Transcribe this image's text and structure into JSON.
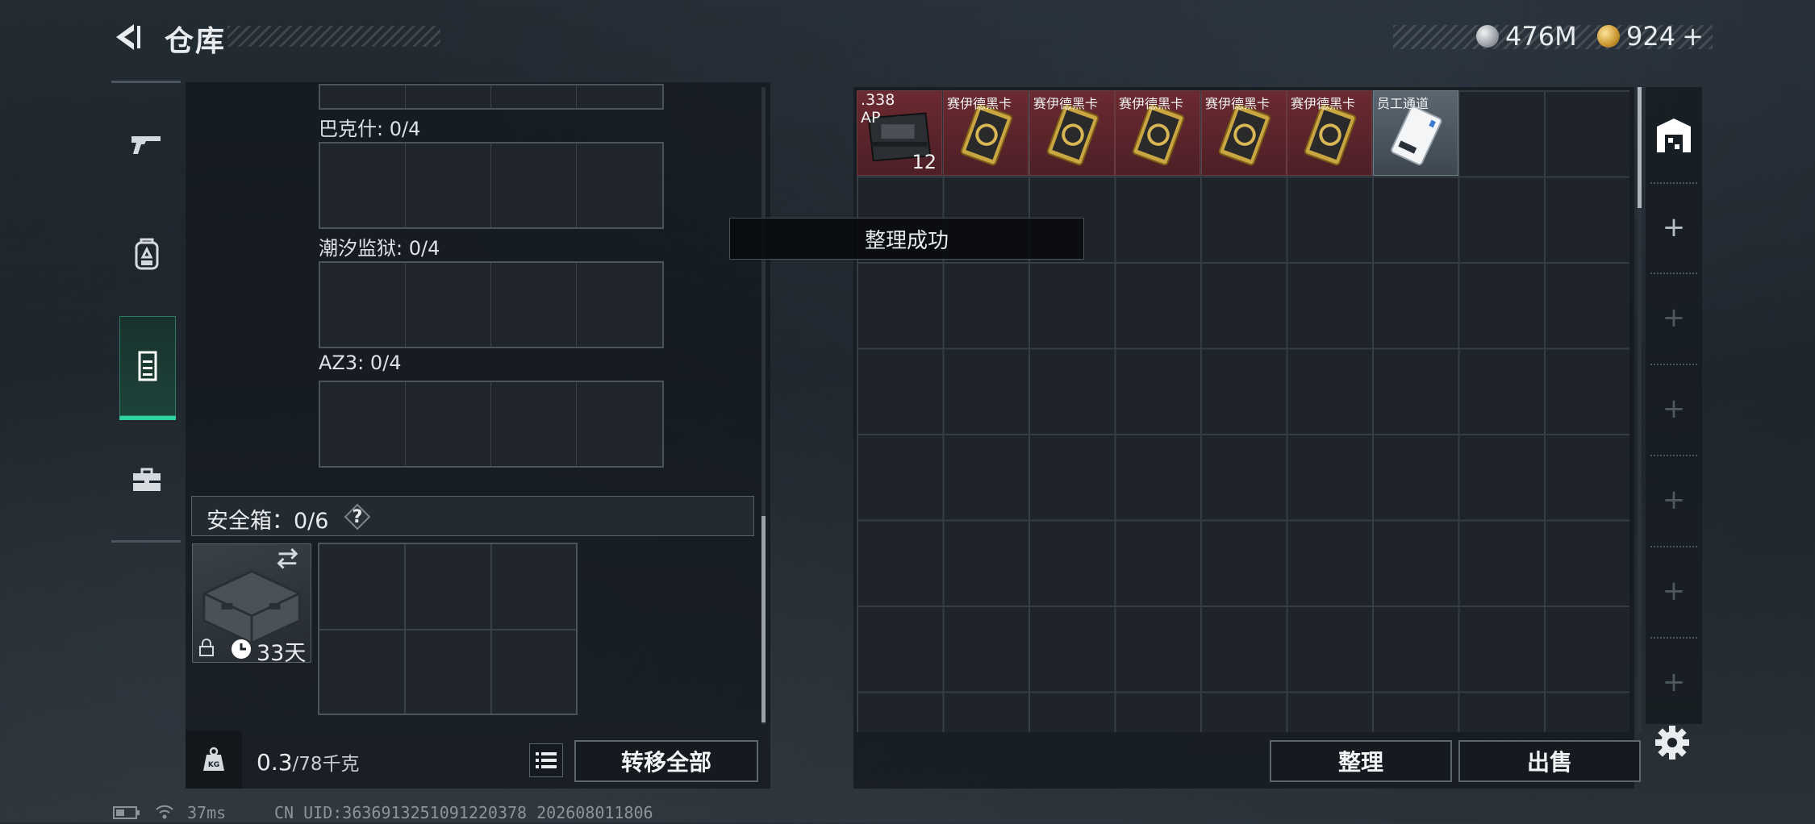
{
  "header": {
    "title": "仓库",
    "currency": [
      {
        "icon": "silver-coin-icon",
        "value": "476M"
      },
      {
        "icon": "gold-coin-icon",
        "value": "924"
      }
    ],
    "add_symbol": "+"
  },
  "nav": {
    "items": [
      "pistol-icon",
      "backpack-icon",
      "chest-rig-icon",
      "toolbox-icon"
    ],
    "active_index": 2
  },
  "left_panel": {
    "slots": [
      {
        "label": "巴克什: 0/4"
      },
      {
        "label": "潮汐监狱: 0/4"
      },
      {
        "label": "AZ3: 0/4"
      }
    ],
    "safe_box": {
      "label": "安全箱：0/6",
      "help": "?",
      "days": "33天"
    },
    "weight": {
      "current": "0.3",
      "max": "/78千克"
    },
    "transfer_all": "转移全部"
  },
  "inventory": {
    "items": [
      {
        "name": ".338",
        "sub": "AP",
        "count": "12",
        "type": "ammo",
        "bg": "red"
      },
      {
        "name": "赛伊德黑卡",
        "type": "card",
        "bg": "red"
      },
      {
        "name": "赛伊德黑卡",
        "type": "card",
        "bg": "red"
      },
      {
        "name": "赛伊德黑卡",
        "type": "card",
        "bg": "red"
      },
      {
        "name": "赛伊德黑卡",
        "type": "card",
        "bg": "red"
      },
      {
        "name": "赛伊德黑卡",
        "type": "card",
        "bg": "red"
      },
      {
        "name": "员工通道",
        "type": "keycard",
        "bg": "gray"
      }
    ],
    "toast": "整理成功",
    "sort_button": "整理",
    "sell_button": "出售"
  },
  "right_column": {
    "plus": "+"
  },
  "status_bar": {
    "ping": "37ms",
    "uid": "CN UID:3636913251091220378 202608011806"
  },
  "colors": {
    "accent": "#2fd3a0",
    "item_red": "#6b2a31",
    "panel": "#141a1f"
  }
}
